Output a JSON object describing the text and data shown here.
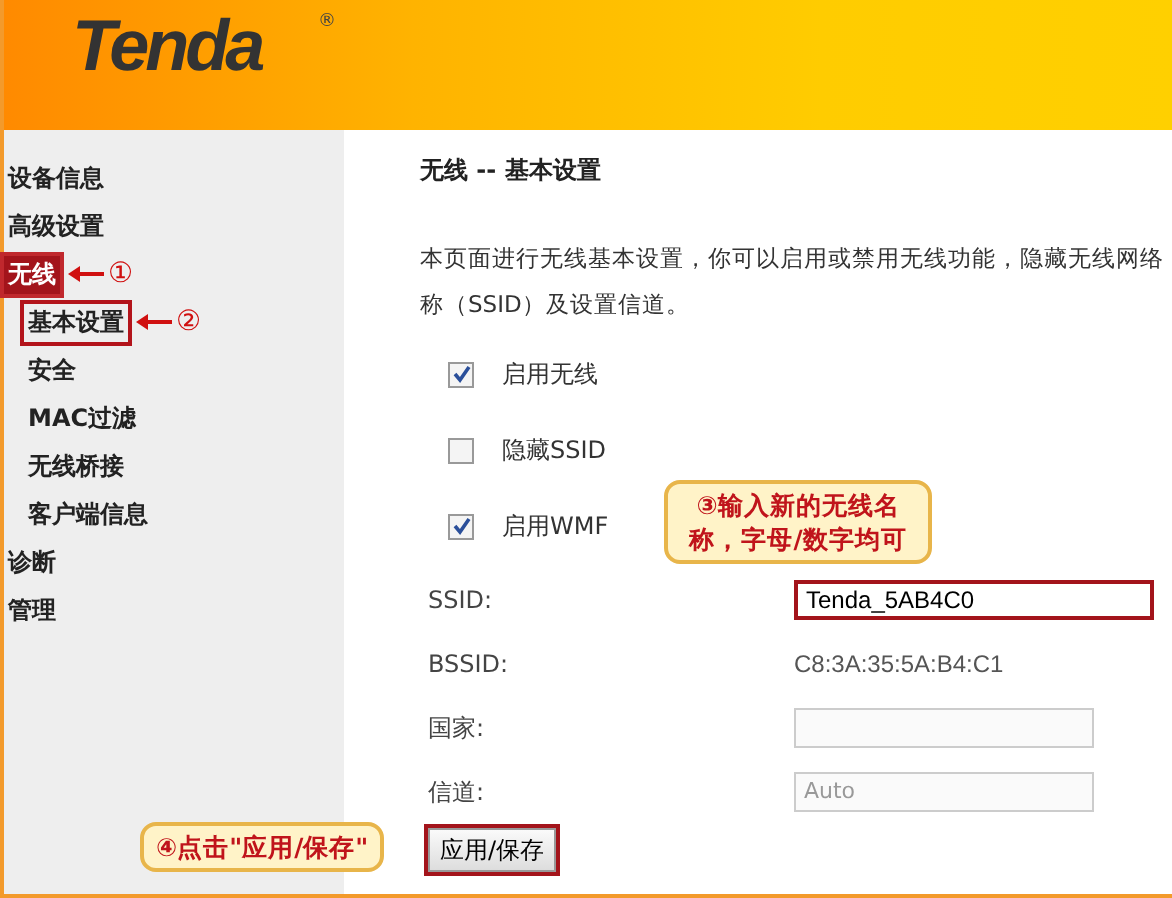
{
  "logo": {
    "text": "Tenda",
    "mark": "®"
  },
  "sidebar": {
    "items": [
      {
        "label": "设备信息",
        "selected": false
      },
      {
        "label": "高级设置",
        "selected": false
      },
      {
        "label": "无线",
        "selected": true,
        "marker": "①",
        "children": [
          {
            "label": "基本设置",
            "selected": true,
            "marker": "②"
          },
          {
            "label": "安全",
            "selected": false
          },
          {
            "label": "MAC过滤",
            "selected": false
          },
          {
            "label": "无线桥接",
            "selected": false
          },
          {
            "label": "客户端信息",
            "selected": false
          }
        ]
      },
      {
        "label": "诊断",
        "selected": false
      },
      {
        "label": "管理",
        "selected": false
      }
    ]
  },
  "content": {
    "title": "无线 -- 基本设置",
    "description": "本页面进行无线基本设置，你可以启用或禁用无线功能，隐藏无线网络称（SSID）及设置信道。",
    "checkboxes": [
      {
        "label": "启用无线",
        "checked": true
      },
      {
        "label": "隐藏SSID",
        "checked": false
      },
      {
        "label": "启用WMF",
        "checked": true
      }
    ],
    "fields": [
      {
        "label": "SSID:",
        "kind": "input",
        "value": "Tenda_5AB4C0",
        "highlighted": true
      },
      {
        "label": "BSSID:",
        "kind": "text",
        "value": "C8:3A:35:5A:B4:C1"
      },
      {
        "label": "国家:",
        "kind": "select"
      },
      {
        "label": "信道:",
        "kind": "select",
        "value": "Auto"
      }
    ],
    "button": {
      "label": "应用/保存",
      "highlighted": true
    }
  },
  "callouts": [
    {
      "kind": "ssid",
      "text": "③输入新的无线名称，字母/数字均可"
    },
    {
      "kind": "button",
      "text": "④点击\"应用/保存\""
    }
  ]
}
